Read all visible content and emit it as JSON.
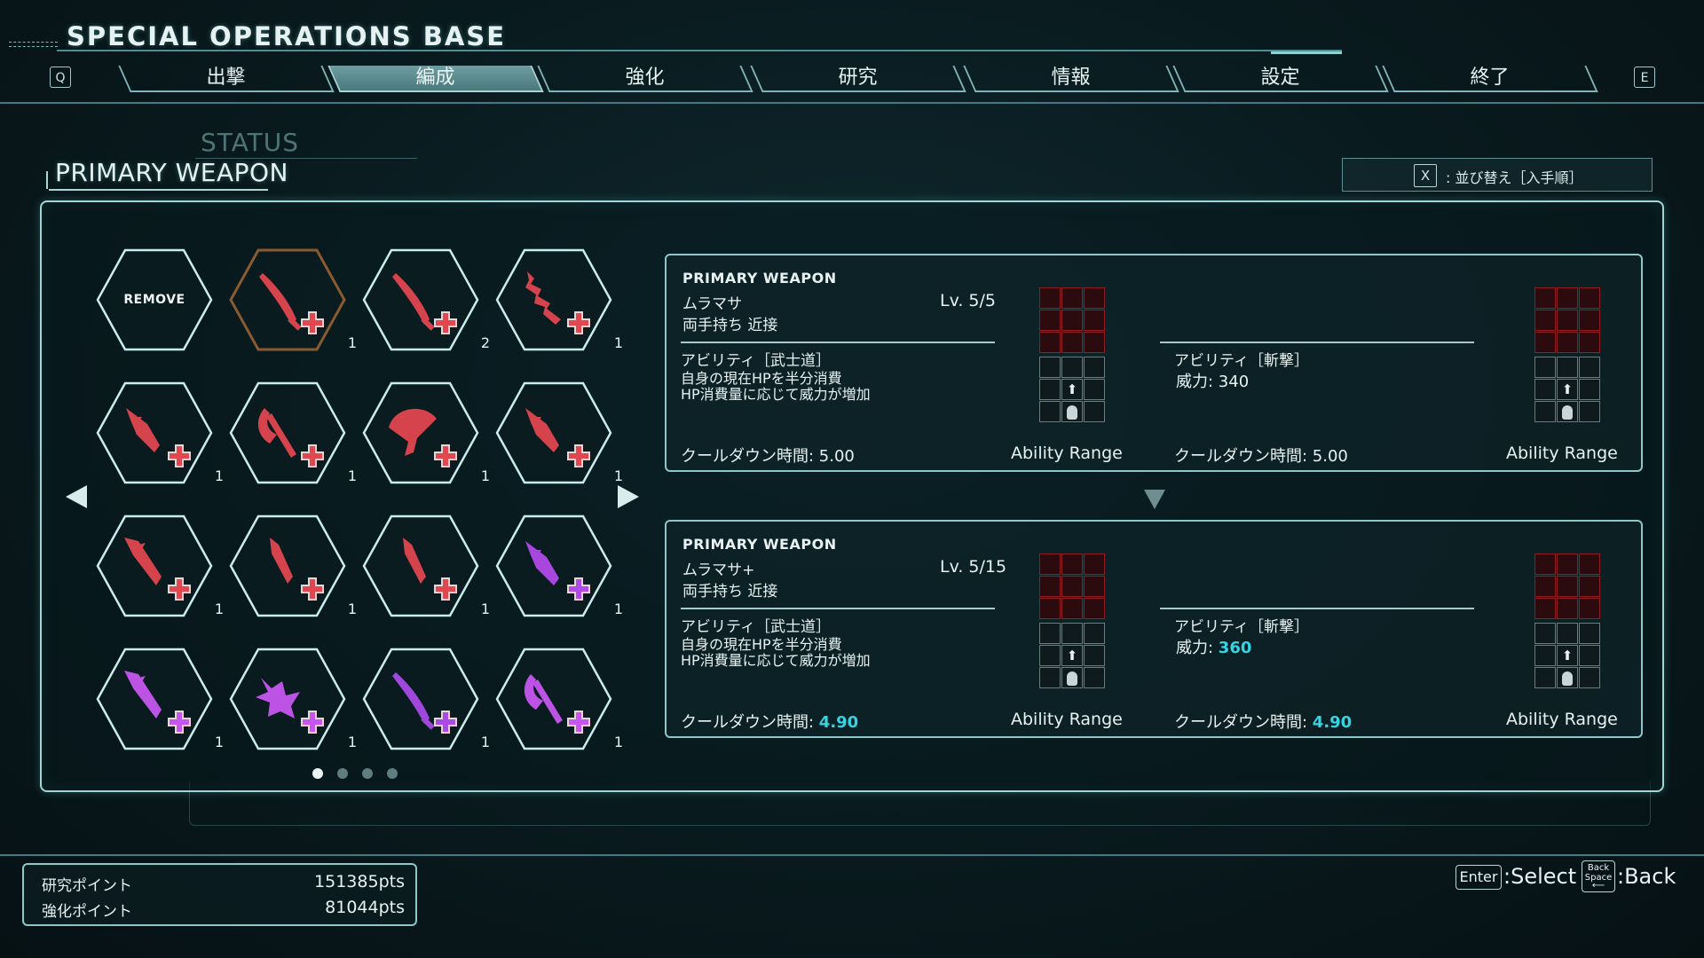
{
  "header": {
    "title": "SPECIAL OPERATIONS BASE",
    "prev_key": "Q",
    "next_key": "E",
    "tabs": [
      {
        "label": "出撃",
        "active": false
      },
      {
        "label": "編成",
        "active": true
      },
      {
        "label": "強化",
        "active": false
      },
      {
        "label": "研究",
        "active": false
      },
      {
        "label": "情報",
        "active": false
      },
      {
        "label": "設定",
        "active": false
      },
      {
        "label": "終了",
        "active": false
      }
    ]
  },
  "background_label": "STATUS",
  "section": {
    "title": "PRIMARY WEAPON",
    "sort_key": "X",
    "sort_label": ": 並び替え［入手順］"
  },
  "inventory": {
    "remove_label": "REMOVE",
    "items": [
      {
        "icon": "katana-icon",
        "color": "#e0474f",
        "count": "1",
        "selected": true
      },
      {
        "icon": "katana-icon",
        "color": "#e0474f",
        "count": "2"
      },
      {
        "icon": "serrated-blade-icon",
        "color": "#e0474f",
        "count": "1"
      },
      {
        "icon": "spear-icon",
        "color": "#e0474f",
        "count": "1"
      },
      {
        "icon": "axe-icon",
        "color": "#e0474f",
        "count": "1"
      },
      {
        "icon": "fan-blade-icon",
        "color": "#e0474f",
        "count": "1"
      },
      {
        "icon": "spear-icon",
        "color": "#e0474f",
        "count": "1"
      },
      {
        "icon": "greatsword-icon",
        "color": "#e0474f",
        "count": "1"
      },
      {
        "icon": "dagger-icon",
        "color": "#e0474f",
        "count": "1"
      },
      {
        "icon": "dagger-icon",
        "color": "#e0474f",
        "count": "1"
      },
      {
        "icon": "spear-icon",
        "color": "#b04ae8",
        "count": "1"
      },
      {
        "icon": "greatsword-icon",
        "color": "#c656ef",
        "count": "1"
      },
      {
        "icon": "horned-helm-icon",
        "color": "#c656ef",
        "count": "1"
      },
      {
        "icon": "katana-icon",
        "color": "#a74ae6",
        "count": "1"
      },
      {
        "icon": "axe-icon",
        "color": "#c656ef",
        "count": "1"
      }
    ],
    "pages": 4,
    "current_page": 1
  },
  "current_weapon": {
    "header": "PRIMARY WEAPON",
    "name": "ムラマサ",
    "level": "Lv. 5/5",
    "type": "両手持ち 近接",
    "ability1_title": "アビリティ［武士道］",
    "ability1_desc": "自身の現在HPを半分消費\nHP消費量に応じて威力が増加",
    "cooldown1_label": "クールダウン時間: ",
    "cooldown1_value": "5.00",
    "range_label": "Ability Range",
    "ability2_title": "アビリティ［斬撃］",
    "power_label": "威力: ",
    "power_value": "340",
    "cooldown2_label": "クールダウン時間: ",
    "cooldown2_value": "5.00",
    "range2_label": "Ability Range"
  },
  "next_weapon": {
    "header": "PRIMARY WEAPON",
    "name": "ムラマサ+",
    "level": "Lv. 5/15",
    "type": "両手持ち 近接",
    "ability1_title": "アビリティ［武士道］",
    "ability1_desc": "自身の現在HPを半分消費\nHP消費量に応じて威力が増加",
    "cooldown1_label": "クールダウン時間: ",
    "cooldown1_value": "4.90",
    "range_label": "Ability Range",
    "ability2_title": "アビリティ［斬撃］",
    "power_label": "威力: ",
    "power_value": "360",
    "cooldown2_label": "クールダウン時間: ",
    "cooldown2_value": "4.90",
    "range2_label": "Ability Range"
  },
  "points": {
    "research_label": "研究ポイント",
    "research_value": "151385pts",
    "upgrade_label": "強化ポイント",
    "upgrade_value": "81044pts"
  },
  "controls": {
    "select_key": "Enter",
    "select_label": ":Select",
    "back_key_line1": "Back",
    "back_key_line2": "Space",
    "back_label": ":Back"
  },
  "colors": {
    "accent": "#9fd6d8",
    "highlight": "#36d3e2",
    "red_range": "#8f1d24",
    "weapon_red": "#e0474f",
    "weapon_purple": "#c656ef"
  }
}
